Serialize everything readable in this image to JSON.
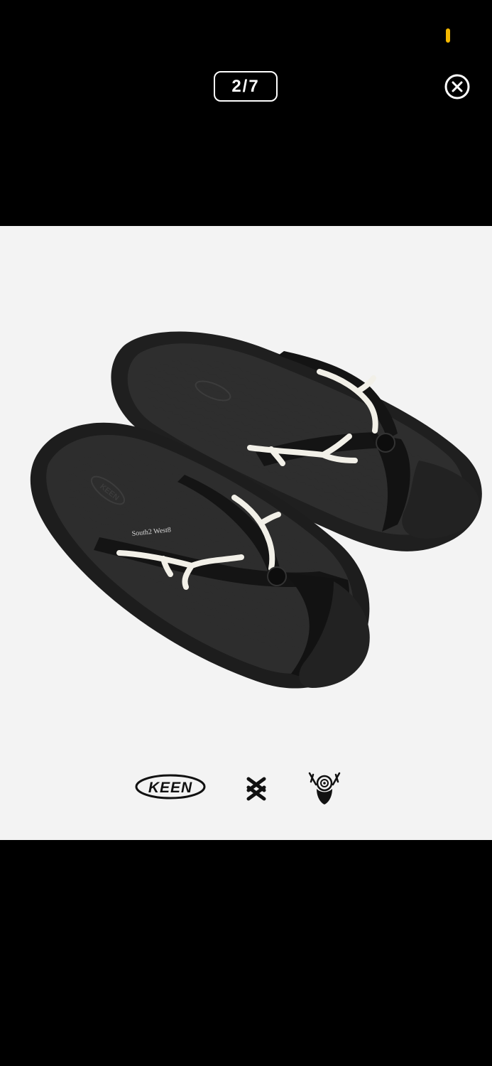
{
  "viewer": {
    "counter": "2/7",
    "close_label": "close",
    "accent_color": "#f5b800"
  },
  "photo": {
    "background": "#f3f3f3",
    "subject": "pair of black flip-flop sandals with white antler ornaments",
    "strap_tag": "South2 West8",
    "sole_logo": "KEEN",
    "logos": {
      "left": "KEEN",
      "center_icon": "butterfly-logo-icon",
      "right_icon": "skull-antler-target-icon"
    }
  }
}
